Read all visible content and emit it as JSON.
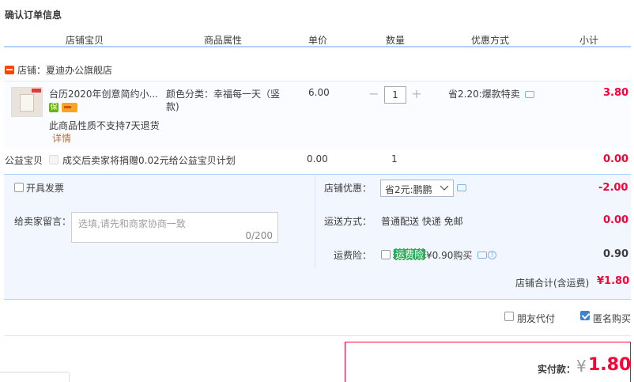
{
  "page_title": "确认订单信息",
  "columns": [
    "店铺宝贝",
    "商品属性",
    "单价",
    "数量",
    "优惠方式",
    "小计"
  ],
  "shop": {
    "label": "店铺：",
    "name": "夏迪办公旗舰店"
  },
  "item": {
    "name": "台历2020年创意简约小...",
    "attr_label": "颜色分类：",
    "attr_value": "幸福每一天（竖",
    "attr_value2": "款)",
    "price": "6.00",
    "quantity": "1",
    "promo": "省2.20:爆款特卖",
    "subtotal": "3.80",
    "no_return": "此商品性质不支持7天退货",
    "detail_link": "详情",
    "badge_text": "保"
  },
  "charity": {
    "label": "公益宝贝",
    "desc": "成交后卖家将捐赠0.02元给公益宝贝计划",
    "price": "0.00",
    "quantity": "1",
    "subtotal": "0.00"
  },
  "invoice": {
    "label": "开具发票"
  },
  "message": {
    "label": "给卖家留言：",
    "placeholder": "选填,请先和商家协商一致",
    "counter": "0/200"
  },
  "shop_discount": {
    "label": "店铺优惠：",
    "selected": "省2元:鹏鹏",
    "amount": "-2.00"
  },
  "shipping": {
    "label": "运送方式：",
    "value": "普通配送 快递 免邮",
    "amount": "0.00"
  },
  "insurance": {
    "label": "运费险：",
    "tag": "运费险",
    "price_text": "¥0.90购买",
    "amount": "0.90"
  },
  "shop_total": {
    "label": "店铺合计(含运费)",
    "amount": "¥1.80"
  },
  "friend_pay": {
    "label": "朋友代付"
  },
  "anonymous": {
    "label": "匿名购买"
  },
  "payment": {
    "label": "实付款：",
    "currency": "¥",
    "amount": "1.80"
  },
  "colors": {
    "accent_red": "#ff0036",
    "header_line": "#b2d1ff",
    "panel_bg": "#f2f7ff"
  }
}
